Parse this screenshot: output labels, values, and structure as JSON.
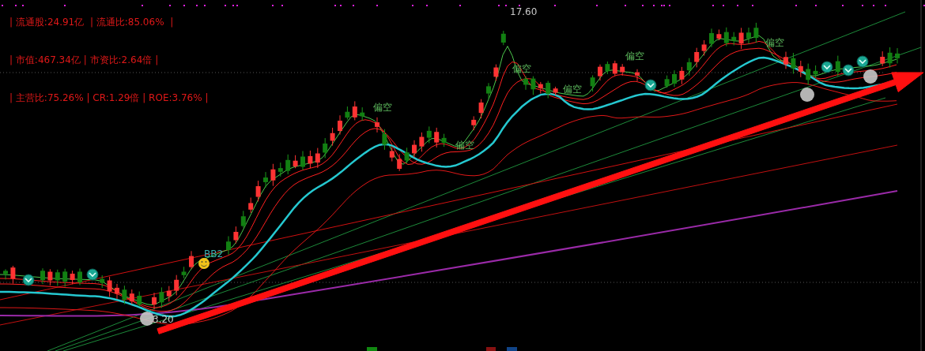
{
  "info_lines": [
    "| 流通股:24.91亿  | 流通比:85.06%  |",
    "| 市值:467.34亿 | 市资比:2.64倍 |",
    "| 主营比:75.26% | CR:1.29倍 | ROE:3.76% |"
  ],
  "annotations": [
    {
      "kind": "signal",
      "text": "偏空"
    },
    {
      "kind": "signal",
      "text": "偏空"
    },
    {
      "kind": "signal",
      "text": "偏空"
    },
    {
      "kind": "signal",
      "text": "偏空"
    },
    {
      "kind": "signal",
      "text": "偏空"
    },
    {
      "kind": "signal",
      "text": "偏空"
    },
    {
      "kind": "high",
      "text": "17.60"
    },
    {
      "kind": "pattern",
      "text": "BB2"
    },
    {
      "kind": "low",
      "text": "3.20"
    }
  ]
}
